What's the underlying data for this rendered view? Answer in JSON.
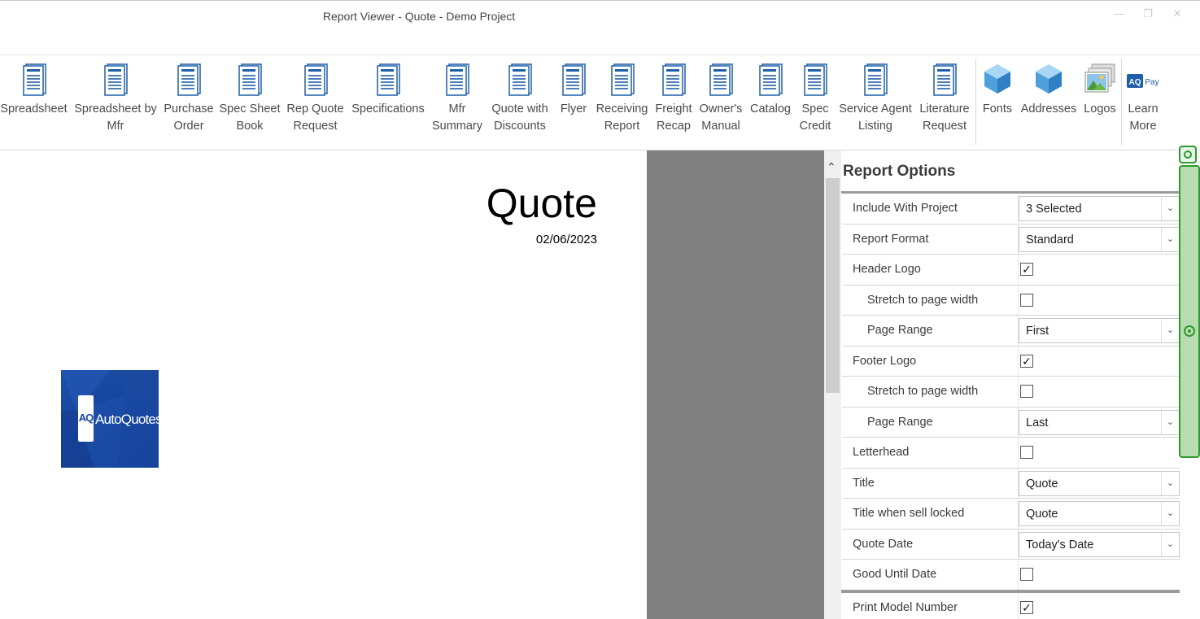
{
  "window": {
    "title": "Report Viewer - Quote - Demo Project",
    "minimize": "—",
    "restore": "❐",
    "close": "✕"
  },
  "ribbon": {
    "buttons": [
      {
        "label": "Spreadsheet",
        "icon": "report-document-icon"
      },
      {
        "label": "Spreadsheet by\nMfr",
        "icon": "report-document-icon"
      },
      {
        "label": "Purchase\nOrder",
        "icon": "report-document-icon"
      },
      {
        "label": "Spec Sheet\nBook",
        "icon": "report-document-icon"
      },
      {
        "label": "Rep Quote\nRequest",
        "icon": "report-document-icon"
      },
      {
        "label": "Specifications",
        "icon": "report-document-icon"
      },
      {
        "label": "Mfr\nSummary",
        "icon": "report-document-icon"
      },
      {
        "label": "Quote with\nDiscounts",
        "icon": "report-document-icon"
      },
      {
        "label": "Flyer",
        "icon": "report-document-icon"
      },
      {
        "label": "Receiving\nReport",
        "icon": "report-document-icon"
      },
      {
        "label": "Freight\nRecap",
        "icon": "report-document-icon"
      },
      {
        "label": "Owner's\nManual",
        "icon": "report-document-icon"
      },
      {
        "label": "Catalog",
        "icon": "report-document-icon"
      },
      {
        "label": "Spec\nCredit",
        "icon": "report-document-icon"
      },
      {
        "label": "Service Agent\nListing",
        "icon": "report-document-icon"
      },
      {
        "label": "Literature\nRequest",
        "icon": "report-document-icon"
      }
    ],
    "settings": [
      {
        "label": "Fonts",
        "icon": "cube-icon"
      },
      {
        "label": "Addresses",
        "icon": "cube-icon"
      },
      {
        "label": "Logos",
        "icon": "images-icon"
      }
    ],
    "learn_more": {
      "label": "Learn\nMore",
      "icon": "aq-pay-icon",
      "badge_aq": "AQ",
      "badge_pay": "Pay"
    }
  },
  "document": {
    "title": "Quote",
    "date": "02/06/2023",
    "logo": {
      "mark": "AQ",
      "brand": "AutoQuotes"
    }
  },
  "report_options": {
    "heading": "Report Options",
    "rows": [
      {
        "label": "Include With Project",
        "type": "combo",
        "value": "3 Selected",
        "indent": false
      },
      {
        "label": "Report Format",
        "type": "combo",
        "value": "Standard",
        "indent": false
      },
      {
        "label": "Header Logo",
        "type": "check",
        "checked": true,
        "indent": false
      },
      {
        "label": "Stretch to page width",
        "type": "check",
        "checked": false,
        "indent": true
      },
      {
        "label": "Page Range",
        "type": "combo",
        "value": "First",
        "indent": true
      },
      {
        "label": "Footer Logo",
        "type": "check",
        "checked": true,
        "indent": false
      },
      {
        "label": "Stretch to page width",
        "type": "check",
        "checked": false,
        "indent": true
      },
      {
        "label": "Page Range",
        "type": "combo",
        "value": "Last",
        "indent": true
      },
      {
        "label": "Letterhead",
        "type": "check",
        "checked": false,
        "indent": false
      },
      {
        "label": "Title",
        "type": "combo",
        "value": "Quote",
        "indent": false
      },
      {
        "label": "Title when sell locked",
        "type": "combo",
        "value": "Quote",
        "indent": false
      },
      {
        "label": "Quote Date",
        "type": "combo",
        "value": "Today's Date",
        "indent": false
      },
      {
        "label": "Good Until Date",
        "type": "check",
        "checked": false,
        "indent": false
      },
      {
        "label": "Print Model Number",
        "type": "check",
        "checked": true,
        "indent": false
      }
    ]
  },
  "colors": {
    "accent_green": "#2e9a2e",
    "doc_icon_blue": "#1f5fa8",
    "gray_pane": "#808080"
  }
}
